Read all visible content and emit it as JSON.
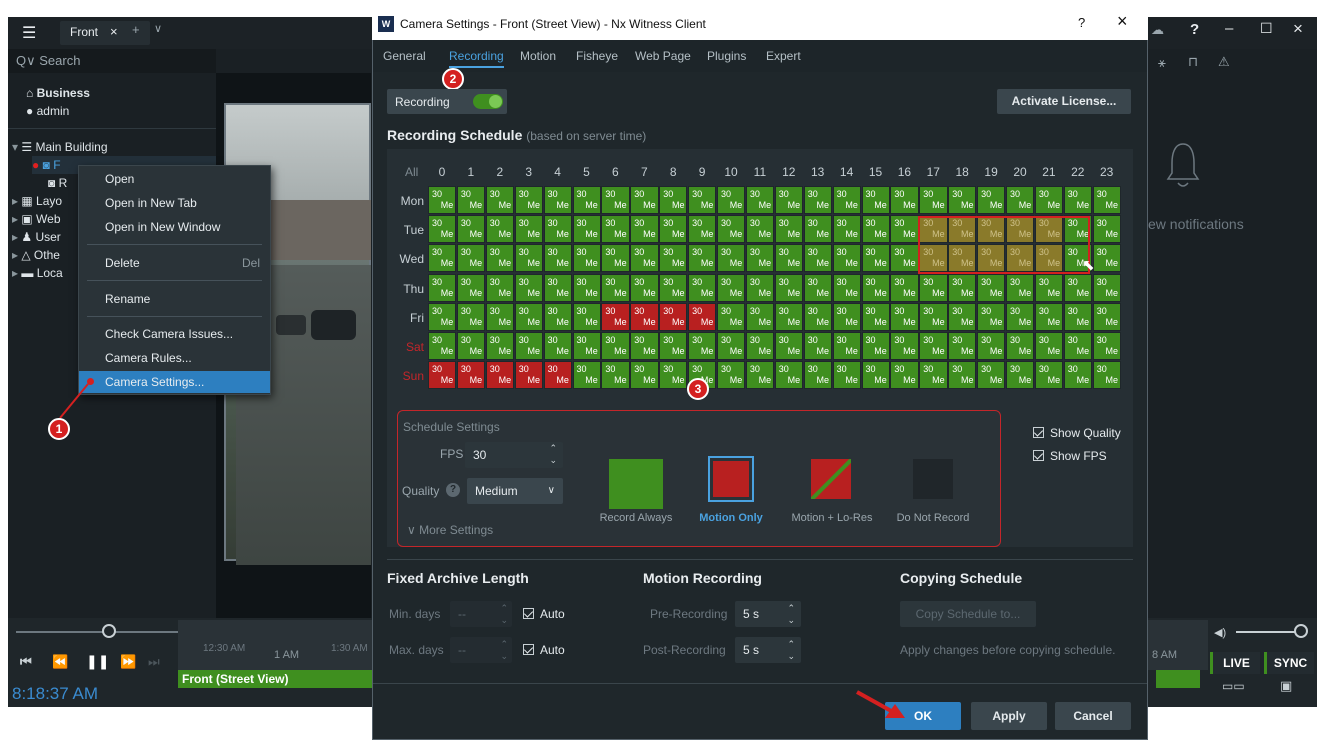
{
  "client": {
    "tab_label": "Front",
    "search_placeholder": "Search",
    "tree": [
      {
        "label": "Business",
        "icon": "home-icon"
      },
      {
        "label": "admin",
        "icon": "user-icon"
      },
      {
        "label": "Main Building",
        "icon": "server-icon"
      },
      {
        "label": "F",
        "icon": "camera-icon"
      },
      {
        "label": "R",
        "icon": "camera-icon"
      },
      {
        "label": "Layo",
        "icon": "layout-icon"
      },
      {
        "label": "Web",
        "icon": "web-icon"
      },
      {
        "label": "User",
        "icon": "users-icon"
      },
      {
        "label": "Othe",
        "icon": "other-icon"
      },
      {
        "label": "Loca",
        "icon": "folder-icon"
      }
    ],
    "notifications_text": "ew notifications",
    "time_display": "8:18:37 AM",
    "timeline_labels": [
      "12:30 AM",
      "1 AM",
      "1:30 AM"
    ],
    "timeline_right_label": "8 AM",
    "camera_strip_label": "Front (Street View)",
    "live_label": "LIVE",
    "sync_label": "SYNC"
  },
  "context_menu": {
    "items": [
      {
        "label": "Open",
        "shortcut": ""
      },
      {
        "label": "Open in New Tab",
        "shortcut": ""
      },
      {
        "label": "Open in New Window",
        "shortcut": ""
      },
      {
        "label": "Delete",
        "shortcut": "Del"
      },
      {
        "label": "Rename",
        "shortcut": ""
      },
      {
        "label": "Check Camera Issues...",
        "shortcut": ""
      },
      {
        "label": "Camera Rules...",
        "shortcut": ""
      },
      {
        "label": "Camera Settings...",
        "shortcut": ""
      }
    ],
    "highlighted": "Camera Settings..."
  },
  "dialog": {
    "title": "Camera Settings - Front (Street View) - Nx Witness Client",
    "help_label": "?",
    "close_label": "×",
    "tabs": [
      "General",
      "Recording",
      "Motion",
      "Fisheye",
      "Web Page",
      "Plugins",
      "Expert"
    ],
    "active_tab": "Recording",
    "recording_toggle_label": "Recording",
    "recording_on": true,
    "activate_license_label": "Activate License...",
    "schedule_title": "Recording Schedule",
    "schedule_subtitle": "(based on server time)",
    "all_label": "All",
    "hours": [
      "0",
      "1",
      "2",
      "3",
      "4",
      "5",
      "6",
      "7",
      "8",
      "9",
      "10",
      "11",
      "12",
      "13",
      "14",
      "15",
      "16",
      "17",
      "18",
      "19",
      "20",
      "21",
      "22",
      "23"
    ],
    "days": [
      "Mon",
      "Tue",
      "Wed",
      "Thu",
      "Fri",
      "Sat",
      "Sun"
    ],
    "cell_fps": "30",
    "cell_quality": "Me",
    "schedule_grid": [
      "gggggggggggggggggggggggg",
      "gggggggggggggggggsssssg g",
      "gggggggggggggggggsssssgg",
      "gggggggggggggggggggggggg",
      "ggggggrrrrgggggggggggggg",
      "gggggggggggggggggggggggg",
      "rrrrrggggggggggggggggggg"
    ],
    "schedule_settings": {
      "title": "Schedule Settings",
      "fps_label": "FPS",
      "fps_value": "30",
      "quality_label": "Quality",
      "quality_value": "Medium",
      "more_settings_label": "More Settings",
      "modes": [
        {
          "label": "Record Always",
          "color": "#3f8f1f"
        },
        {
          "label": "Motion Only",
          "color": "#b82020"
        },
        {
          "label": "Motion + Lo-Res",
          "color": "#b82020"
        },
        {
          "label": "Do Not Record",
          "color": "#20262a"
        }
      ],
      "selected_mode": "Motion Only",
      "show_quality_label": "Show Quality",
      "show_fps_label": "Show FPS"
    },
    "fixed_archive": {
      "title": "Fixed Archive Length",
      "min_label": "Min. days",
      "max_label": "Max. days",
      "placeholder": "--",
      "auto_label": "Auto"
    },
    "motion_recording": {
      "title": "Motion Recording",
      "pre_label": "Pre-Recording",
      "pre_value": "5 s",
      "post_label": "Post-Recording",
      "post_value": "5 s"
    },
    "copying": {
      "title": "Copying Schedule",
      "button_label": "Copy Schedule to...",
      "note": "Apply changes before copying schedule."
    },
    "ok_label": "OK",
    "apply_label": "Apply",
    "cancel_label": "Cancel"
  },
  "steps": [
    "1",
    "2",
    "3"
  ],
  "colors": {
    "accent": "#2d7fc0",
    "record_green": "#3f8f1f",
    "motion_red": "#b82020",
    "badge_red": "#d42020"
  }
}
